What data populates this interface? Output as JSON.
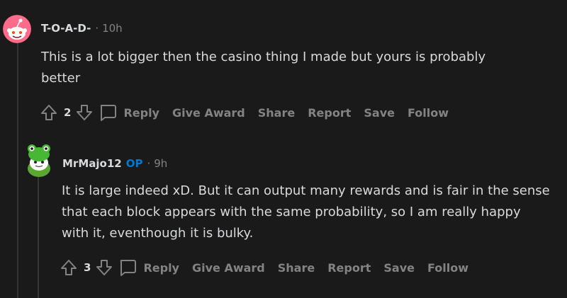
{
  "comments": [
    {
      "username": "T-O-A-D-",
      "separator": "·",
      "time": "10h",
      "body": "This is a lot bigger then the casino thing I made but yours is probably better",
      "score": "2",
      "avatar_icon": "pink-snoo-avatar-icon"
    },
    {
      "username": "MrMajo12",
      "badge": "OP",
      "separator": "·",
      "time": "9h",
      "body": "It is large indeed xD. But it can output many rewards and is fair in the sense that each block appears with the same probability, so I am really happy with it, eventhough it is bulky.",
      "score": "3",
      "avatar_icon": "green-frog-hat-snoo-avatar-icon"
    }
  ],
  "actions": {
    "reply": "Reply",
    "give_award": "Give Award",
    "share": "Share",
    "report": "Report",
    "save": "Save",
    "follow": "Follow"
  },
  "colors": {
    "background": "#1a1a1b",
    "text": "#d7dadc",
    "muted": "#818384",
    "op_badge": "#0079d3",
    "thread_line": "#343536"
  }
}
